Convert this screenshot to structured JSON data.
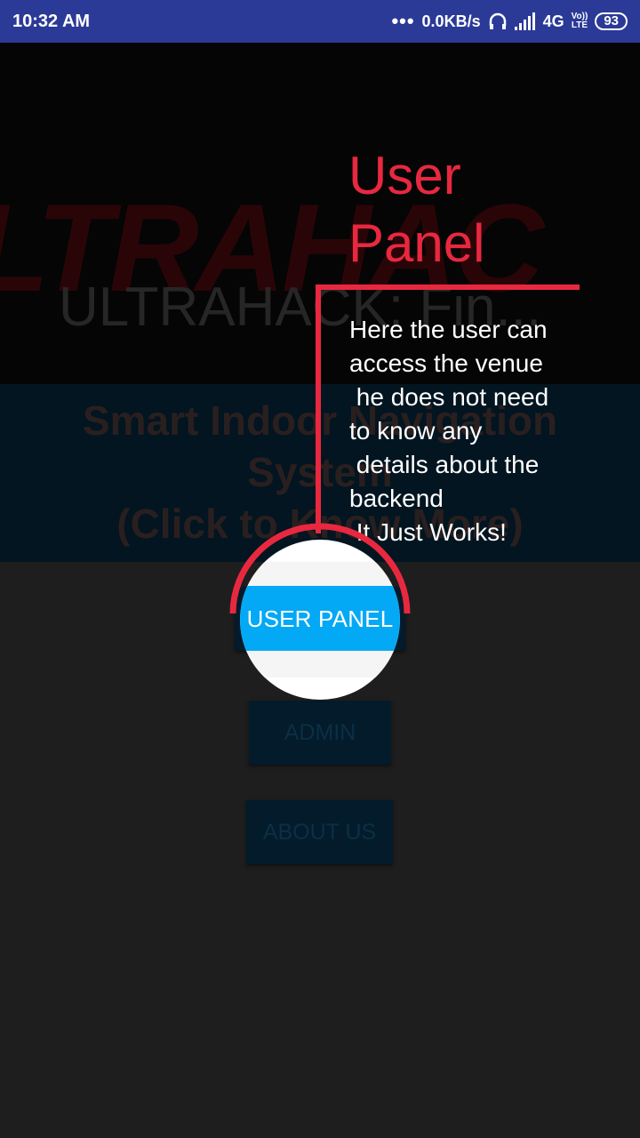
{
  "status_bar": {
    "time": "10:32 AM",
    "network_speed": "0.0KB/s",
    "network_type": "4G",
    "volte_top": "Vo))",
    "volte_bottom": "LTE",
    "battery": "93"
  },
  "app": {
    "title": "ULTRAHACK: Fin...",
    "banner_line1": "Smart Indoor Navigation",
    "banner_line2": "System",
    "banner_line3": "(Click to Know More)",
    "buttons": {
      "admin": "ADMIN",
      "about": "ABOUT US"
    }
  },
  "tutorial": {
    "title_line1": "User",
    "title_line2": "Panel",
    "description": "Here the user can\naccess the venue\n he does not need\nto know any\n details about the\nbackend\n It Just Works!",
    "highlight_button": "USER PANEL",
    "accent_color": "#e8283f"
  },
  "colors": {
    "status_bar": "#2b3a97",
    "user_button": "#03a9f4"
  }
}
